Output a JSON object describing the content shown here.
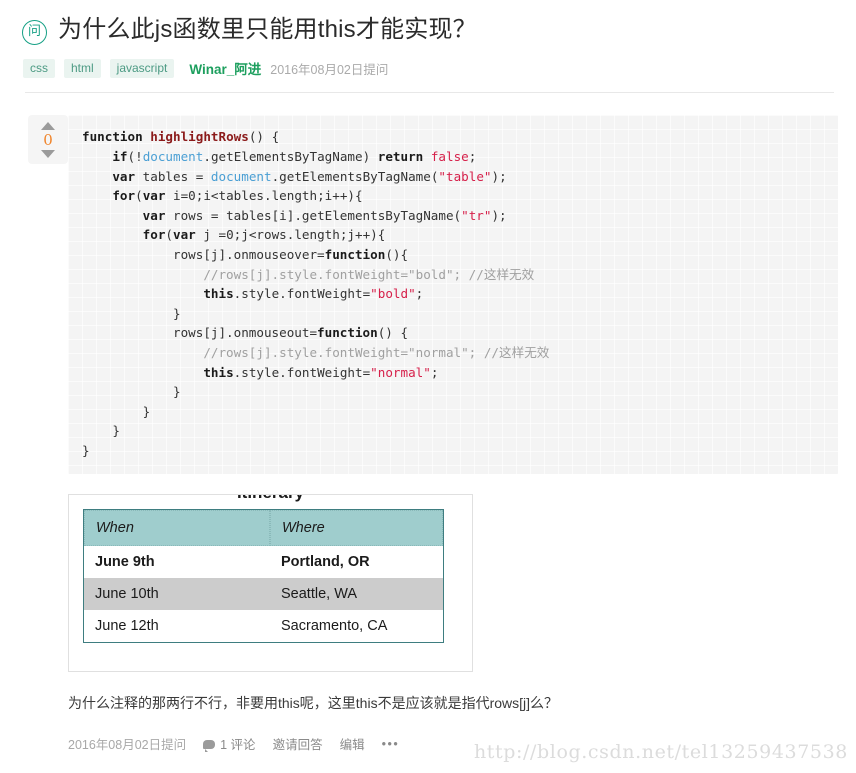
{
  "question": {
    "badge_icon": "ask-badge-icon",
    "badge_label": "问",
    "title": "为什么此js函数里只能用this才能实现？",
    "tags": [
      "css",
      "html",
      "javascript"
    ],
    "author": "Winar_阿进",
    "ask_date": "2016年08月02日提问",
    "vote_count": "0",
    "up_icon": "triangle-up-icon",
    "down_icon": "triangle-down-icon",
    "body_text": "为什么注释的那两行不行，非要用this呢，这里this不是应该就是指代rows[j]么？"
  },
  "code": {
    "language": "javascript",
    "lines": [
      "function highlightRows() {",
      "    if(!document.getElementsByTagName) return false;",
      "    var tables = document.getElementsByTagName(\"table\");",
      "    for(var i=0;i<tables.length;i++){",
      "        var rows = tables[i].getElementsByTagName(\"tr\");",
      "        for(var j =0;j<rows.length;j++){",
      "            rows[j].onmouseover=function(){",
      "                //rows[j].style.fontWeight=\"bold\"; //这样无效",
      "                this.style.fontWeight=\"bold\";",
      "            }",
      "            rows[j].onmouseout=function() {",
      "                //rows[j].style.fontWeight=\"normal\"; //这样无效",
      "                this.style.fontWeight=\"normal\";",
      "            }",
      "        }",
      "    }",
      "}"
    ]
  },
  "demo_table": {
    "caption": "Itinerary",
    "headers": [
      "When",
      "Where"
    ],
    "rows": [
      {
        "when": "June 9th",
        "where": "Portland, OR",
        "style": "bold"
      },
      {
        "when": "June 10th",
        "where": "Seattle, WA",
        "style": "gray"
      },
      {
        "when": "June 12th",
        "where": "Sacramento, CA",
        "style": "plain"
      }
    ],
    "header_bg": "#9fcdcd",
    "row_gray_bg": "#cccccc",
    "border_color": "#3e7d80"
  },
  "footer": {
    "date": "2016年08月02日提问",
    "comment_icon": "comment-bubble-icon",
    "comment_label": "1 评论",
    "invite_label": "邀请回答",
    "edit_label": "编辑",
    "more_label": "•••"
  },
  "watermark": "http://blog.csdn.net/tel13259437538",
  "colors": {
    "accent_green": "#16a085",
    "author_green": "#1d9f5e",
    "vote_orange": "#f0842a",
    "tag_bg": "#eaf4f0",
    "tag_text": "#4d9b84"
  }
}
